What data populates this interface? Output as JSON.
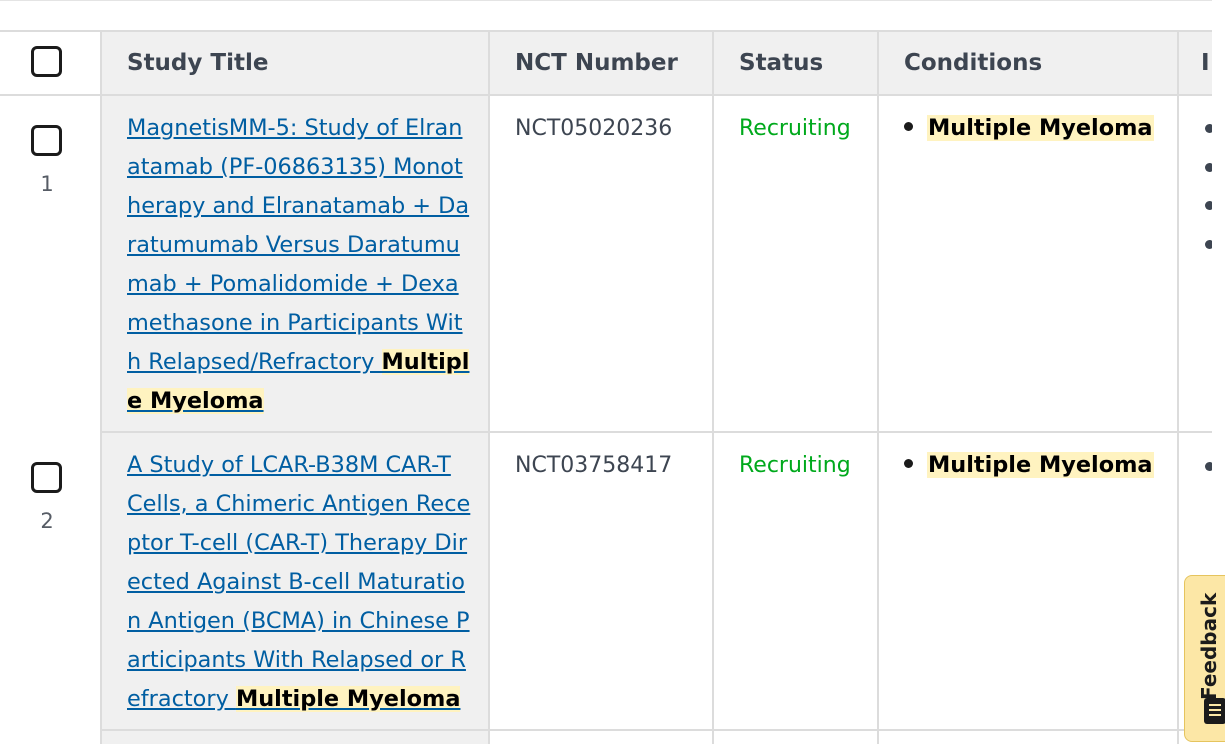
{
  "table": {
    "headers": {
      "title": "Study Title",
      "nct": "NCT Number",
      "status": "Status",
      "conditions": "Conditions",
      "next": "I"
    },
    "rows": [
      {
        "num": "1",
        "title_plain": "MagnetisMM-5: Study of Elranatamab (PF-06863135) Monotherapy and Elranatamab + Daratumumab Versus Daratumumab + Pomalidomide + Dexamethasone in Participants With Relapsed/Refractory ",
        "title_highlight": "Multiple Myeloma",
        "nct": "NCT05020236",
        "status": "Recruiting",
        "condition": "Multiple Myeloma"
      },
      {
        "num": "2",
        "title_plain": "A Study of LCAR-B38M CAR-T Cells, a Chimeric Antigen Receptor T-cell (CAR-T) Therapy Directed Against B-cell Maturation Antigen (BCMA) in Chinese Participants With Relapsed or Refractory ",
        "title_highlight": "Multiple Myeloma",
        "nct": "NCT03758417",
        "status": "Recruiting",
        "condition": "Multiple Myeloma"
      }
    ]
  },
  "feedback": {
    "label": "Feedback",
    "icon": "feedback-icon"
  },
  "colors": {
    "link": "#005ea2",
    "status_recruiting": "#00a91c",
    "highlight": "#fff3c0",
    "header_bg": "#f0f0f0"
  }
}
